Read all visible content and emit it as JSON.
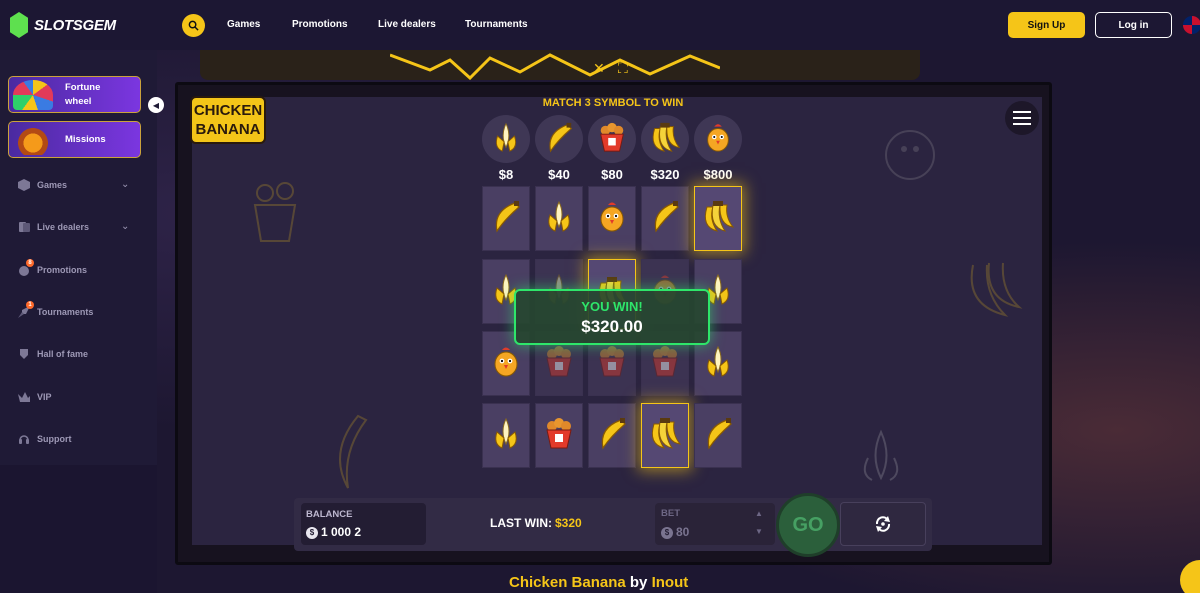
{
  "header": {
    "logo_text": "SLOTSGEM",
    "nav": [
      "Games",
      "Promotions",
      "Live dealers",
      "Tournaments"
    ],
    "signup_label": "Sign Up",
    "login_label": "Log in"
  },
  "sidebar": {
    "promo_cards": [
      {
        "label_line1": "Fortune",
        "label_line2": "wheel"
      },
      {
        "label_line1": "Missions",
        "label_line2": ""
      }
    ],
    "items": [
      {
        "label": "Games",
        "icon": "dice-icon",
        "has_chevron": true
      },
      {
        "label": "Live dealers",
        "icon": "cards-icon",
        "has_chevron": true
      },
      {
        "label": "Promotions",
        "icon": "gift-icon",
        "badge": "8"
      },
      {
        "label": "Tournaments",
        "icon": "rocket-icon",
        "badge": "1"
      },
      {
        "label": "Hall of fame",
        "icon": "shield-icon"
      },
      {
        "label": "VIP",
        "icon": "crown-icon"
      },
      {
        "label": "Support",
        "icon": "headset-icon"
      }
    ]
  },
  "game": {
    "logo_line1": "CHICKEN",
    "logo_line2": "BANANA",
    "match_title": "MATCH 3 SYMBOL TO WIN",
    "paytable": [
      {
        "symbol": "banana-peeled",
        "value": "$8"
      },
      {
        "symbol": "banana-single",
        "value": "$40"
      },
      {
        "symbol": "chicken-bucket",
        "value": "$80"
      },
      {
        "symbol": "banana-bunch",
        "value": "$320"
      },
      {
        "symbol": "chicken",
        "value": "$800"
      }
    ],
    "grid": [
      [
        "banana-single",
        "banana-peeled",
        "chicken",
        "banana-single",
        "banana-bunch"
      ],
      [
        "banana-peeled",
        "banana-peeled",
        "banana-bunch",
        "chicken",
        "banana-peeled"
      ],
      [
        "chicken",
        "chicken-bucket",
        "chicken-bucket",
        "chicken-bucket",
        "banana-peeled"
      ],
      [
        "banana-peeled",
        "chicken-bucket",
        "banana-single",
        "banana-bunch",
        "banana-single"
      ]
    ],
    "win_popup": {
      "title": "YOU WIN!",
      "amount": "$320.00"
    },
    "balance_label": "BALANCE",
    "balance_value": "1 000 2",
    "last_win_label": "LAST WIN:",
    "last_win_value": "$320",
    "bet_label": "BET",
    "bet_value": "80",
    "go_label": "GO",
    "caption_title": "Chicken Banana",
    "caption_by": "by",
    "caption_provider": "Inout"
  },
  "colors": {
    "accent": "#f5c518",
    "win_green": "#2ee66a",
    "sidebar_bg": "#1f1a36",
    "tile_bg": "#4a3f63"
  }
}
